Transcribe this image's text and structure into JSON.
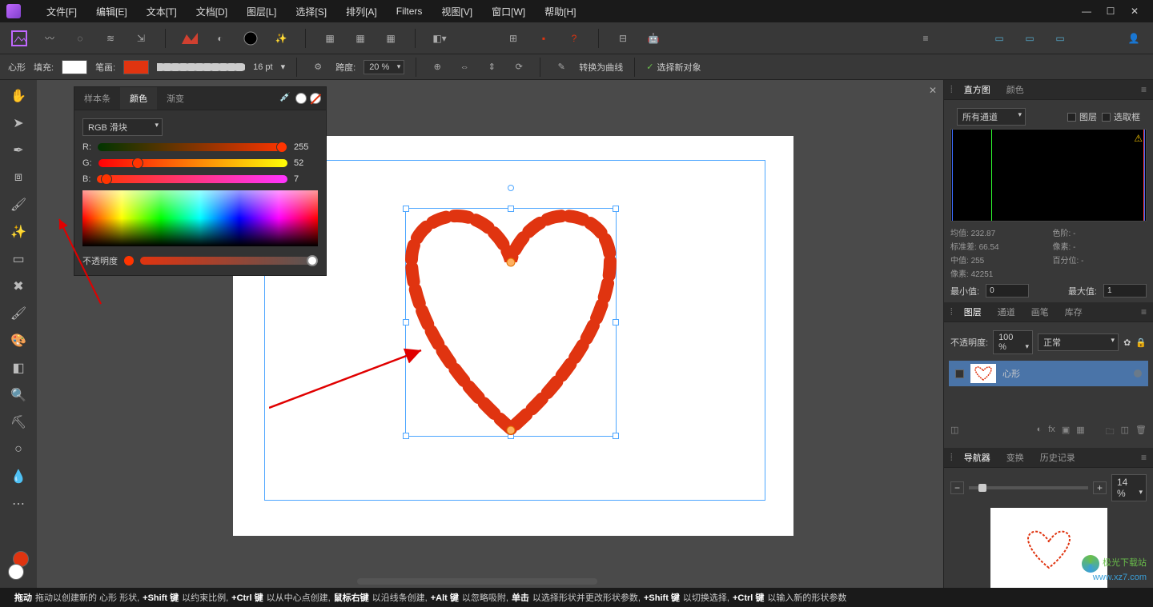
{
  "menu": {
    "file": "文件[F]",
    "edit": "编辑[E]",
    "text": "文本[T]",
    "document": "文档[D]",
    "layer": "图层[L]",
    "select": "选择[S]",
    "arrange": "排列[A]",
    "filters": "Filters",
    "view": "视图[V]",
    "window": "窗口[W]",
    "help": "帮助[H]"
  },
  "context": {
    "shape_label": "心形",
    "fill_label": "填充:",
    "pen_label": "笔画:",
    "stroke_width": "16 pt",
    "span_label": "跨度:",
    "span_value": "20 %",
    "convert_label": "转换为曲线",
    "select_new_label": "选择新对象"
  },
  "color_panel": {
    "tab_swatches": "样本条",
    "tab_color": "颜色",
    "tab_gradient": "渐变",
    "model_label": "RGB 滑块",
    "r_label": "R:",
    "g_label": "G:",
    "b_label": "B:",
    "r_value": "255",
    "g_value": "52",
    "b_value": "7",
    "opacity_label": "不透明度"
  },
  "hist_panel": {
    "tab_hist": "直方图",
    "tab_color": "颜色",
    "channel_label": "所有通道",
    "layer_cb": "图层",
    "marquee_cb": "选取框",
    "mean_label": "均值:",
    "mean_val": "232.87",
    "std_label": "标准差:",
    "std_val": "66.54",
    "median_label": "中值:",
    "median_val": "255",
    "pixels_label": "像素:",
    "pixels_val": "42251",
    "levels_label": "色阶:",
    "levels_val": "-",
    "pixcount_label": "像素:",
    "pixcount_val": "-",
    "percent_label": "百分位:",
    "percent_val": "-",
    "min_label": "最小值:",
    "min_val": "0",
    "max_label": "最大值:",
    "max_val": "1"
  },
  "layers_panel": {
    "tab_layers": "图层",
    "tab_channels": "通道",
    "tab_brush": "画笔",
    "tab_stock": "库存",
    "opacity_label": "不透明度:",
    "opacity_val": "100 %",
    "blend_val": "正常",
    "layer_name": "心形"
  },
  "nav_panel": {
    "tab_nav": "导航器",
    "tab_transform": "变换",
    "tab_history": "历史记录",
    "zoom_val": "14 %"
  },
  "status": {
    "s1_b": "拖动",
    "s1": "拖动以创建新的 心形 形状,",
    "s2_b": "+Shift 键",
    "s2": "以约束比例,",
    "s3_b": "+Ctrl 键",
    "s3": "以从中心点创建,",
    "s4_b": "鼠标右键",
    "s4": "以沿线条创建,",
    "s5_b": "+Alt 键",
    "s5": "以忽略吸附,",
    "s6_b": "单击",
    "s6": "以选择形状并更改形状参数,",
    "s7_b": "+Shift 键",
    "s7": "以切换选择,",
    "s8_b": "+Ctrl 键",
    "s8": "以输入新的形状参数"
  },
  "watermark": {
    "name": "极光下载站",
    "url": "www.xz7.com"
  }
}
